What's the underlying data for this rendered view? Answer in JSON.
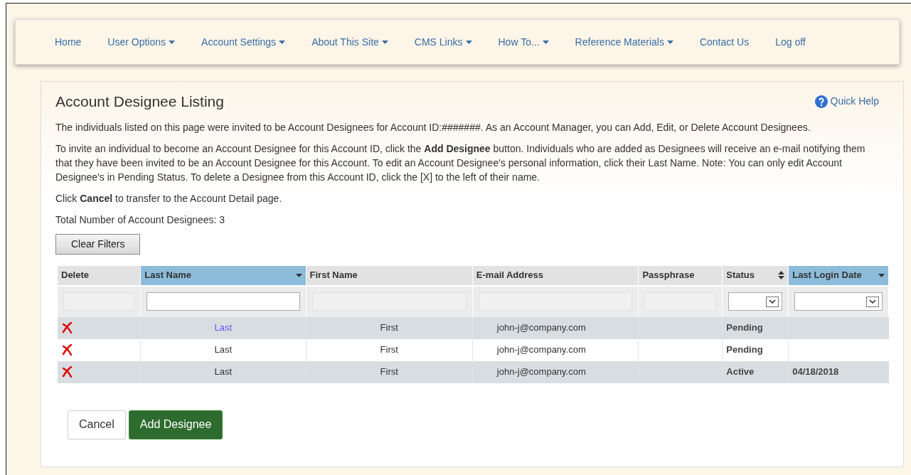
{
  "nav": [
    {
      "label": "Home",
      "dropdown": false
    },
    {
      "label": "User Options",
      "dropdown": true
    },
    {
      "label": "Account Settings",
      "dropdown": true
    },
    {
      "label": "About This Site",
      "dropdown": true
    },
    {
      "label": "CMS Links",
      "dropdown": true
    },
    {
      "label": "How To...",
      "dropdown": true
    },
    {
      "label": "Reference Materials",
      "dropdown": true
    },
    {
      "label": "Contact Us",
      "dropdown": false
    },
    {
      "label": "Log off",
      "dropdown": false
    }
  ],
  "title": "Account Designee Listing",
  "quick_help": "Quick Help",
  "paragraphs": [
    "The individuals listed on this page were invited to be Account Designees for Account ID:#######. As an Account Manager, you can Add, Edit, or Delete Account Designees.",
    "To invite an individual to become an Account Designee for this Account ID, click the **Add Designee** button. Individuals who are added as Designees will receive an e-mail notifying them that they have been invited to be an Account Designee for this Account. To edit an Account Designee's personal information, click their Last Name. Note: You can only edit Account Designee's in Pending Status. To delete a Designee from this Account ID, click the [X] to the left of their name.",
    "Click **Cancel** to transfer to the Account Detail page.",
    "Total Number of Account Designees: 3"
  ],
  "clear_filters": "Clear Filters",
  "table": {
    "columns": [
      {
        "label": "Delete",
        "sorted": false,
        "sortable": false,
        "kind": "blank"
      },
      {
        "label": "Last Name",
        "sorted": true,
        "sortable": true,
        "kind": "text"
      },
      {
        "label": "First Name",
        "sorted": false,
        "sortable": false,
        "kind": "blank"
      },
      {
        "label": "E-mail Address",
        "sorted": false,
        "sortable": false,
        "kind": "blank"
      },
      {
        "label": "Passphrase",
        "sorted": false,
        "sortable": false,
        "kind": "blank"
      },
      {
        "label": "Status",
        "sorted": false,
        "sortable": true,
        "kind": "select"
      },
      {
        "label": "Last Login Date",
        "sorted": true,
        "sortable": true,
        "kind": "select"
      }
    ],
    "rows": [
      {
        "last_name": "Last",
        "link": true,
        "first_name": "First",
        "email": "john-j@company.com",
        "status": "Pending"
      },
      {
        "last_name": "Last",
        "link": false,
        "first_name": "First",
        "email": "john-j@company.com",
        "status": "Pending"
      },
      {
        "last_name": "Last",
        "link": false,
        "first_name": "First",
        "email": "john-j@company.com",
        "status": "Active",
        "last_login": "04/18/2018"
      }
    ]
  },
  "buttons": {
    "cancel": "Cancel",
    "add": "Add Designee"
  }
}
